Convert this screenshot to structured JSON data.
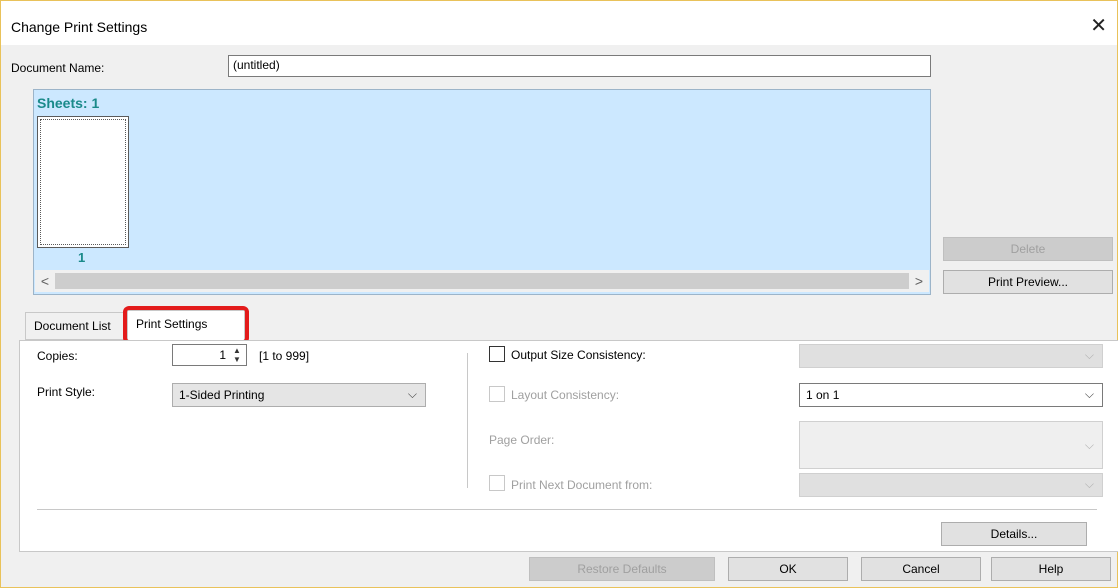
{
  "window": {
    "title": "Change Print Settings",
    "close_glyph": "✕"
  },
  "document_name": {
    "label": "Document Name:",
    "value": "(untitled)"
  },
  "preview": {
    "sheets_label": "Sheets: 1",
    "sheet_number": "1",
    "scroll_left": "<",
    "scroll_right": ">"
  },
  "side_buttons": {
    "delete": "Delete",
    "print_preview": "Print Preview..."
  },
  "tabs": [
    {
      "label": "Document List"
    },
    {
      "label": "Print Settings"
    }
  ],
  "print_settings": {
    "copies_label": "Copies:",
    "copies_value": "1",
    "copies_range": "[1 to 999]",
    "print_style_label": "Print Style:",
    "print_style_value": "1-Sided Printing",
    "output_size_label": "Output Size Consistency:",
    "output_size_value": "",
    "layout_label": "Layout Consistency:",
    "layout_value": "1 on 1",
    "page_order_label": "Page Order:",
    "page_order_value": "",
    "next_doc_label": "Print Next Document from:",
    "next_doc_value": "",
    "details_button": "Details..."
  },
  "footer_buttons": {
    "restore_defaults": "Restore Defaults",
    "ok": "OK",
    "cancel": "Cancel",
    "help": "Help"
  },
  "colors": {
    "preview_bg": "#cce8ff",
    "sheets_text": "#1a8a8a",
    "highlight": "#e31b1b",
    "window_border": "#e9c25a"
  }
}
